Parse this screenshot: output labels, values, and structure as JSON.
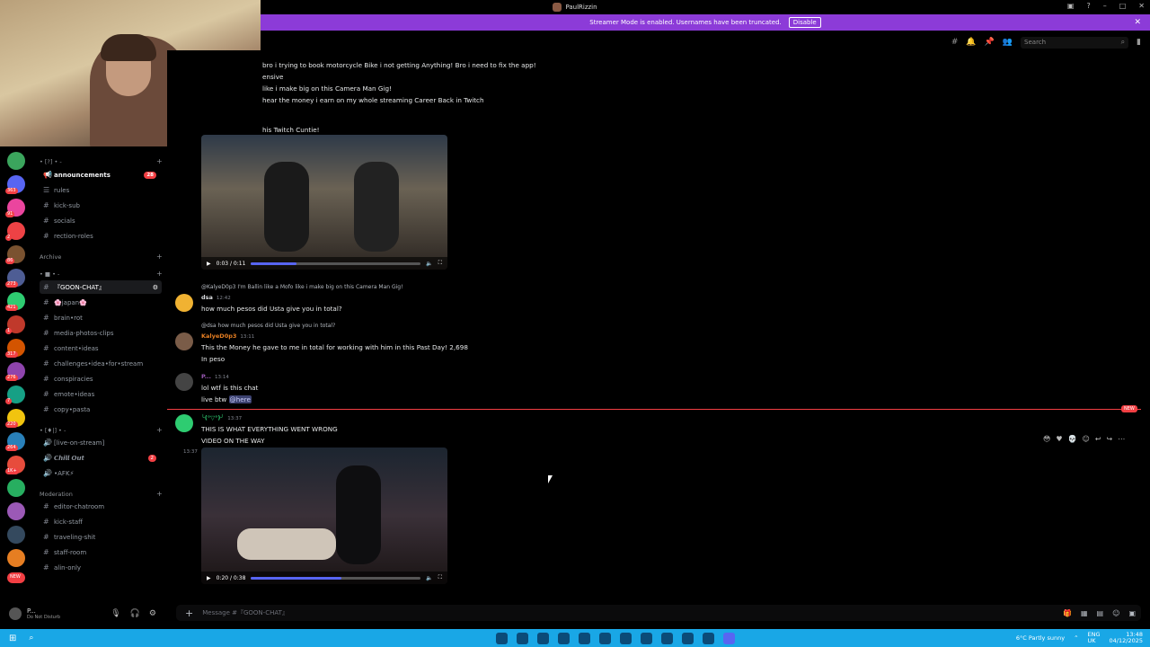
{
  "window": {
    "title": "PaulRizzin"
  },
  "banner": {
    "text": "Streamer Mode is enabled. Usernames have been truncated.",
    "button": "Disable"
  },
  "toolbar": {
    "search_placeholder": "Search"
  },
  "sidebar": {
    "categories": {
      "top": "• [?] • -",
      "archive": "Archive",
      "voice": "• [♦|] • -",
      "moderation": "Moderation",
      "misc": "• ■ • -"
    },
    "channels": [
      {
        "label": "announcements",
        "count": "28"
      },
      {
        "label": "rules"
      },
      {
        "label": "kick-sub"
      },
      {
        "label": "socials"
      },
      {
        "label": "rection-roles"
      },
      {
        "label": "『GOON-CHAT』"
      },
      {
        "label": "🌸japan🌸"
      },
      {
        "label": "brain•rot"
      },
      {
        "label": "media-photos-clips"
      },
      {
        "label": "content•ideas"
      },
      {
        "label": "challenges•idea•for•stream"
      },
      {
        "label": "conspiracies"
      },
      {
        "label": "emote•ideas"
      },
      {
        "label": "copy•pasta"
      },
      {
        "label": "[live-on-stream]"
      },
      {
        "label": "𝘾𝙝𝙞𝙡𝙡 𝙊𝙪𝙩",
        "count": "2"
      },
      {
        "label": "•AFK⚡"
      },
      {
        "label": "editor-chatroom"
      },
      {
        "label": "kick-staff"
      },
      {
        "label": "traveling-shit"
      },
      {
        "label": "staff-room"
      },
      {
        "label": "alin-only"
      }
    ],
    "server_badges": [
      "363",
      "91",
      "2",
      "86",
      "273",
      "421",
      "1",
      "317",
      "276",
      "7",
      "220",
      "264",
      "1K+",
      "NEW"
    ]
  },
  "user": {
    "name": "P...",
    "status": "Do Not Disturb"
  },
  "chat": {
    "top_lines": [
      "bro i trying to book motorcycle Bike i not getting Anything! Bro i need to fix the app!",
      "ensive",
      "like i make big on this Camera Man Gig!",
      "hear the money i earn on my whole streaming Career Back in Twitch",
      "his Twitch Cuntie!"
    ],
    "video1": {
      "time": "0:03 / 0:11",
      "progress": 0.27
    },
    "msg1": {
      "ref": "@KalyeD0p3 I'm Ballin like a Mofo like i make big on this Camera Man Gig!",
      "name": "dsa",
      "time": "12:42",
      "text": "how much pesos did Usta give you in total?"
    },
    "msg2": {
      "ref": "@dsa how much pesos did Usta give you in total?",
      "name": "KalyeD0p3",
      "time": "13:11",
      "text": "This the Money he gave to me in total for working with him in this Past Day! 2,698",
      "text2": "In peso"
    },
    "msg3": {
      "name": "P...",
      "time": "13:14",
      "text": "lol wtf is this chat",
      "text2": "live btw",
      "mention": "@here"
    },
    "new_tag": "NEW",
    "msg4": {
      "name": "╰(°▽°)╯",
      "time": "13:37",
      "text": "THIS IS WHAT EVERYTHING WENT WRONG",
      "text2": "VIDEO ON THE WAY",
      "side_time": "13:37"
    },
    "video2": {
      "time": "0:20 / 0:38",
      "progress": 0.53
    }
  },
  "composer": {
    "placeholder": "Message #『GOON-CHAT』"
  },
  "taskbar": {
    "weather": "6°C  Partly sunny",
    "lang": "ENG",
    "region": "UK",
    "clock": "13:48",
    "date": "04/12/2025"
  }
}
